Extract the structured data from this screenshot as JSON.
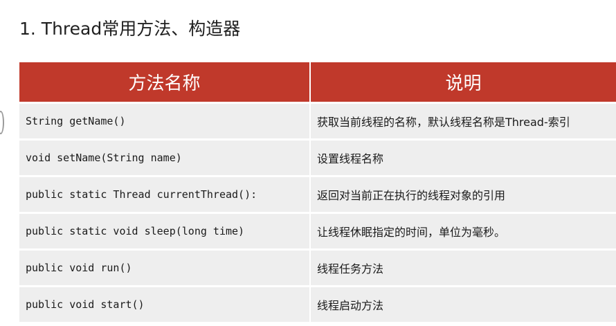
{
  "title": "1. Thread常用方法、构造器",
  "table": {
    "headers": [
      "方法名称",
      "说明"
    ],
    "rows": [
      {
        "method": "String getName()",
        "desc": "获取当前线程的名称，默认线程名称是Thread-索引"
      },
      {
        "method": "void setName(String name)",
        "desc": "设置线程名称"
      },
      {
        "method": "public static Thread currentThread():",
        "desc": "返回对当前正在执行的线程对象的引用"
      },
      {
        "method": "public static void sleep(long time)",
        "desc": "让线程休眠指定的时间，单位为毫秒。"
      },
      {
        "method": "public void run()",
        "desc": "线程任务方法"
      },
      {
        "method": "public void start()",
        "desc": "线程启动方法"
      }
    ]
  }
}
